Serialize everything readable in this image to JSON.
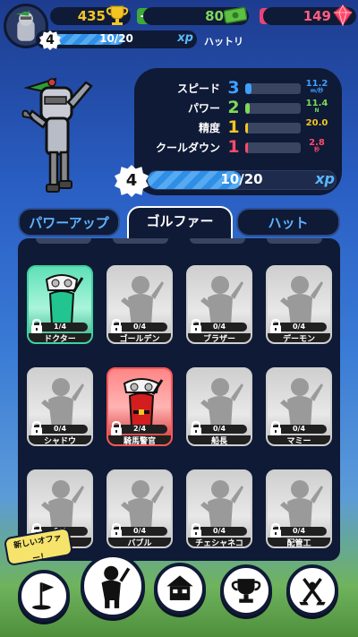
{
  "currency": {
    "coins": "435",
    "cash": "80",
    "gems": "149"
  },
  "player": {
    "level": "4",
    "xp_progress": "10/20",
    "xp_label": "xp",
    "hat_name": "ハットリ",
    "xp_fraction": 0.5
  },
  "stats": [
    {
      "label": "スピード",
      "value": "3",
      "max": "11.2",
      "unit": "m/秒",
      "fill": 0.12,
      "color": "#3fa0ff",
      "val_color": "#3fa0ff"
    },
    {
      "label": "パワー",
      "value": "2",
      "max": "11.4",
      "unit": "N",
      "fill": 0.08,
      "color": "#7ed957",
      "val_color": "#7ed957"
    },
    {
      "label": "精度",
      "value": "1",
      "max": "20.0",
      "unit": "",
      "fill": 0.05,
      "color": "#f3c523",
      "val_color": "#f3c523"
    },
    {
      "label": "クールダウン",
      "value": "1",
      "max": "2.8",
      "unit": "秒",
      "fill": 0.05,
      "color": "#ff4a6a",
      "val_color": "#ff4a6a"
    }
  ],
  "golfer_xp": {
    "level": "4",
    "progress": "10/20",
    "xp_label": "xp",
    "fraction": 0.5
  },
  "tabs": {
    "power_up": "パワーアップ",
    "golfer": "ゴルファー",
    "hat": "ハット"
  },
  "golfers": [
    {
      "name": "ドクター",
      "progress": "1/4",
      "style": "green"
    },
    {
      "name": "ゴールデン",
      "progress": "0/4",
      "style": "locked"
    },
    {
      "name": "ブラザー",
      "progress": "0/4",
      "style": "locked"
    },
    {
      "name": "デーモン",
      "progress": "0/4",
      "style": "locked"
    },
    {
      "name": "シャドウ",
      "progress": "0/4",
      "style": "locked"
    },
    {
      "name": "騎馬警官",
      "progress": "2/4",
      "style": "red"
    },
    {
      "name": "船長",
      "progress": "0/4",
      "style": "locked"
    },
    {
      "name": "マミー",
      "progress": "0/4",
      "style": "locked"
    },
    {
      "name": "ン",
      "progress": "0/4",
      "style": "locked"
    },
    {
      "name": "バブル",
      "progress": "0/4",
      "style": "locked"
    },
    {
      "name": "チェシャネコ",
      "progress": "0/4",
      "style": "locked"
    },
    {
      "name": "配管工",
      "progress": "0/4",
      "style": "locked"
    }
  ],
  "offer_badge": "新しいオファー！",
  "nav": [
    "flag-icon",
    "golfer-icon",
    "shop-icon",
    "trophy-icon",
    "clubs-icon"
  ]
}
